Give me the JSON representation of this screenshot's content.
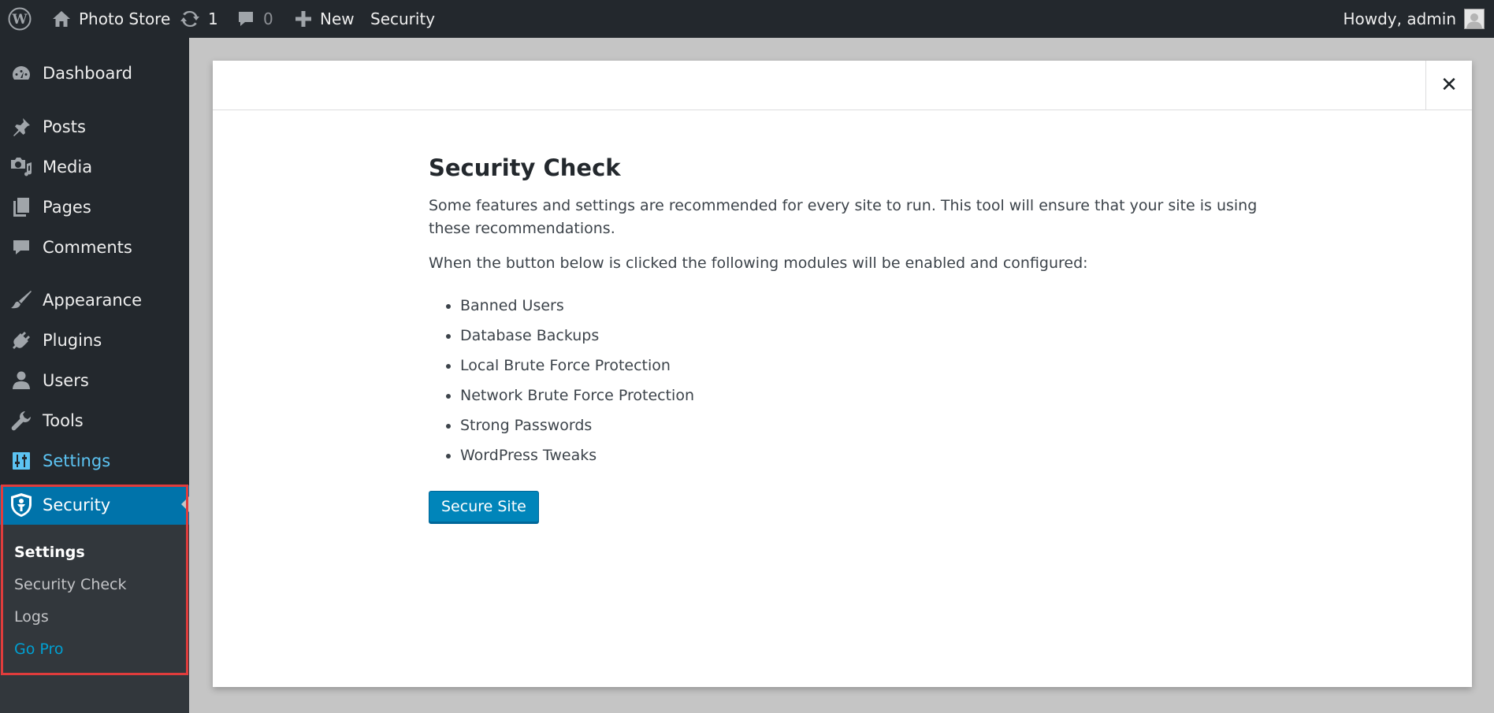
{
  "admin_bar": {
    "site_name": "Photo Store",
    "updates_count": "1",
    "comments_count": "0",
    "new_label": "New",
    "security_label": "Security",
    "account_label": "Howdy, admin",
    "icons": {
      "wordpress": "wordpress-logo-icon",
      "home": "home-icon",
      "updates": "refresh-icon",
      "comments": "comment-bubble-icon",
      "new": "plus-icon",
      "avatar": "user-avatar-icon"
    }
  },
  "sidebar": {
    "items": [
      {
        "label": "Dashboard",
        "icon": "dashboard-gauge-icon"
      },
      {
        "label": "Posts",
        "icon": "pushpin-icon"
      },
      {
        "label": "Media",
        "icon": "camera-music-icon"
      },
      {
        "label": "Pages",
        "icon": "pages-icon"
      },
      {
        "label": "Comments",
        "icon": "comment-icon"
      },
      {
        "label": "Appearance",
        "icon": "paintbrush-icon"
      },
      {
        "label": "Plugins",
        "icon": "plug-icon"
      },
      {
        "label": "Users",
        "icon": "user-icon"
      },
      {
        "label": "Tools",
        "icon": "wrench-icon"
      },
      {
        "label": "Settings",
        "icon": "sliders-icon"
      }
    ],
    "security": {
      "label": "Security",
      "icon": "shield-icon",
      "submenu": [
        "Settings",
        "Security Check",
        "Logs",
        "Go Pro"
      ]
    }
  },
  "modal": {
    "title": "Security Check",
    "paragraph1": "Some features and settings are recommended for every site to run. This tool will ensure that your site is using these recommendations.",
    "paragraph2": "When the button below is clicked the following modules will be enabled and configured:",
    "modules": [
      "Banned Users",
      "Database Backups",
      "Local Brute Force Protection",
      "Network Brute Force Protection",
      "Strong Passwords",
      "WordPress Tweaks"
    ],
    "button_label": "Secure Site",
    "close_symbol": "✕"
  },
  "colors": {
    "admin_bar_bg": "#23282d",
    "menu_bg": "#23282d",
    "submenu_bg": "#32373c",
    "accent": "#0073aa",
    "button": "#0085ba",
    "highlight_border": "#e03c3c",
    "link": "#00a0d2"
  }
}
